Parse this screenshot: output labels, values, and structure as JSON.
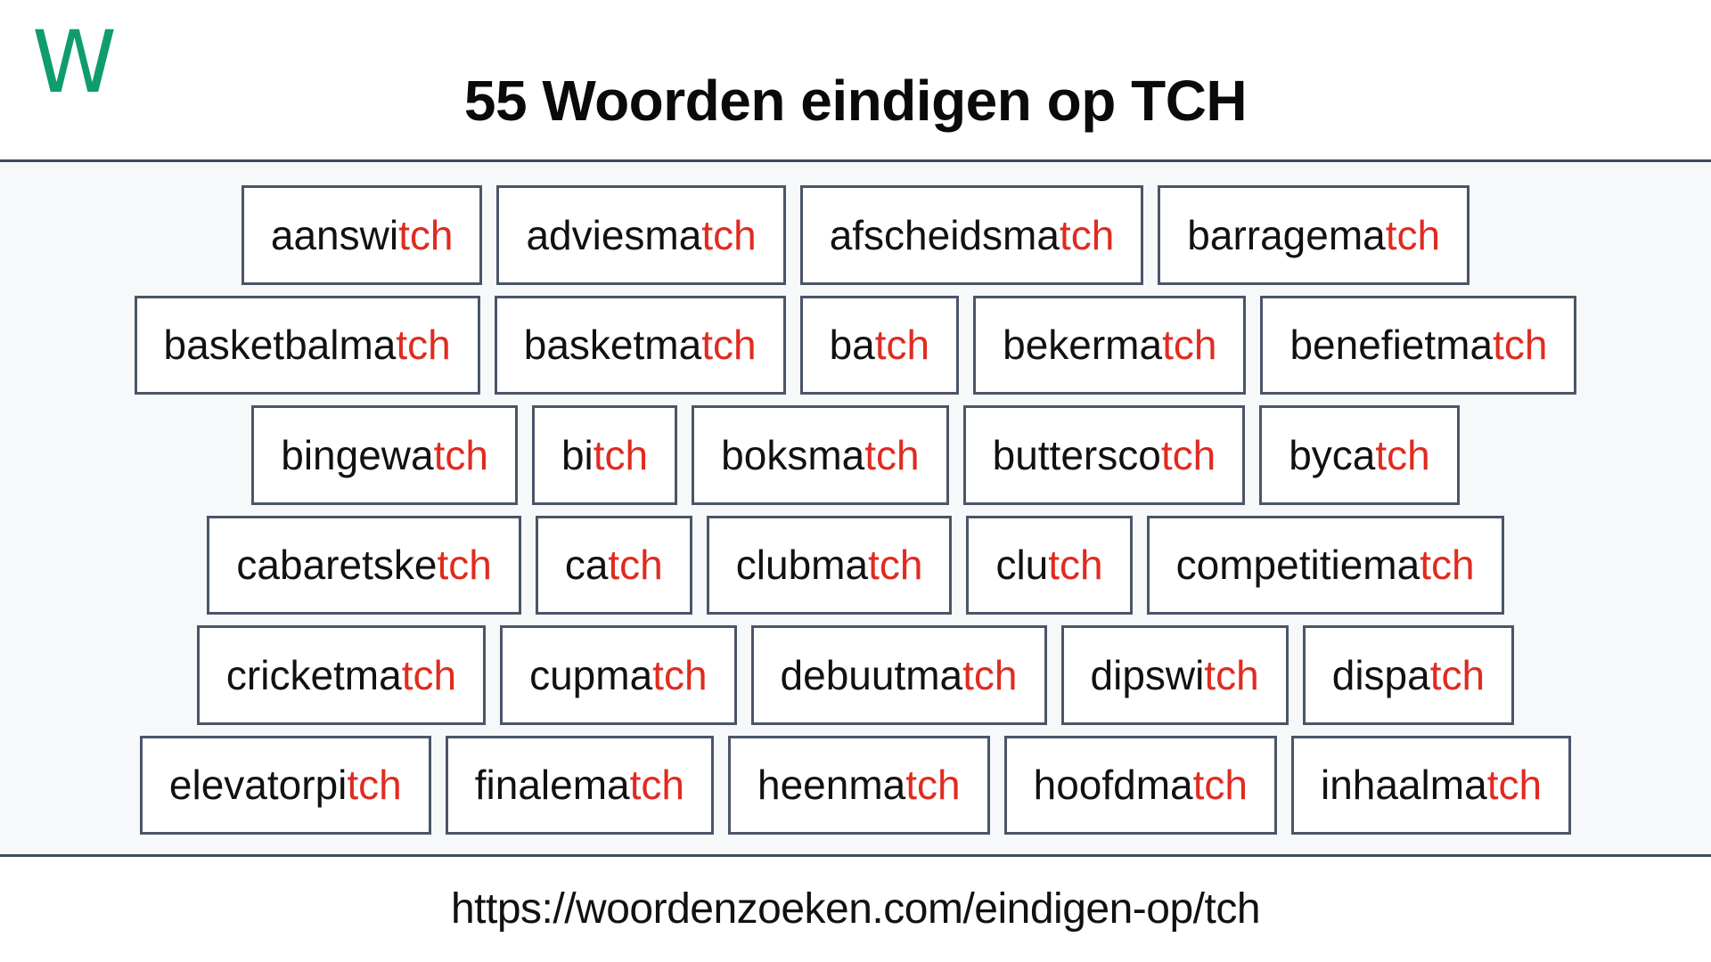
{
  "header": {
    "logo_letter": "W",
    "logo_color": "#0f9d6e",
    "title": "55 Woorden eindigen op TCH"
  },
  "theme": {
    "suffix_color": "#e02b20",
    "border_color": "#4a5568",
    "grid_background": "#f6f8fa",
    "card_background": "#ffffff",
    "text_color": "#111111"
  },
  "word_list": {
    "suffix": "tch",
    "total_count": 55,
    "rows": [
      [
        {
          "prefix": "aanswi",
          "suffix": "tch"
        },
        {
          "prefix": "adviesma",
          "suffix": "tch"
        },
        {
          "prefix": "afscheidsma",
          "suffix": "tch"
        },
        {
          "prefix": "barragema",
          "suffix": "tch"
        }
      ],
      [
        {
          "prefix": "basketbalma",
          "suffix": "tch"
        },
        {
          "prefix": "basketma",
          "suffix": "tch"
        },
        {
          "prefix": "ba",
          "suffix": "tch"
        },
        {
          "prefix": "bekerma",
          "suffix": "tch"
        },
        {
          "prefix": "benefietma",
          "suffix": "tch"
        }
      ],
      [
        {
          "prefix": "bingewa",
          "suffix": "tch"
        },
        {
          "prefix": "bi",
          "suffix": "tch"
        },
        {
          "prefix": "boksma",
          "suffix": "tch"
        },
        {
          "prefix": "buttersco",
          "suffix": "tch"
        },
        {
          "prefix": "byca",
          "suffix": "tch"
        }
      ],
      [
        {
          "prefix": "cabaretske",
          "suffix": "tch"
        },
        {
          "prefix": "ca",
          "suffix": "tch"
        },
        {
          "prefix": "clubma",
          "suffix": "tch"
        },
        {
          "prefix": "clu",
          "suffix": "tch"
        },
        {
          "prefix": "competitiema",
          "suffix": "tch"
        }
      ],
      [
        {
          "prefix": "cricketma",
          "suffix": "tch"
        },
        {
          "prefix": "cupma",
          "suffix": "tch"
        },
        {
          "prefix": "debuutma",
          "suffix": "tch"
        },
        {
          "prefix": "dipswi",
          "suffix": "tch"
        },
        {
          "prefix": "dispa",
          "suffix": "tch"
        }
      ],
      [
        {
          "prefix": "elevatorpi",
          "suffix": "tch"
        },
        {
          "prefix": "finalema",
          "suffix": "tch"
        },
        {
          "prefix": "heenma",
          "suffix": "tch"
        },
        {
          "prefix": "hoofdma",
          "suffix": "tch"
        },
        {
          "prefix": "inhaalma",
          "suffix": "tch"
        }
      ]
    ]
  },
  "footer": {
    "url": "https://woordenzoeken.com/eindigen-op/tch"
  }
}
